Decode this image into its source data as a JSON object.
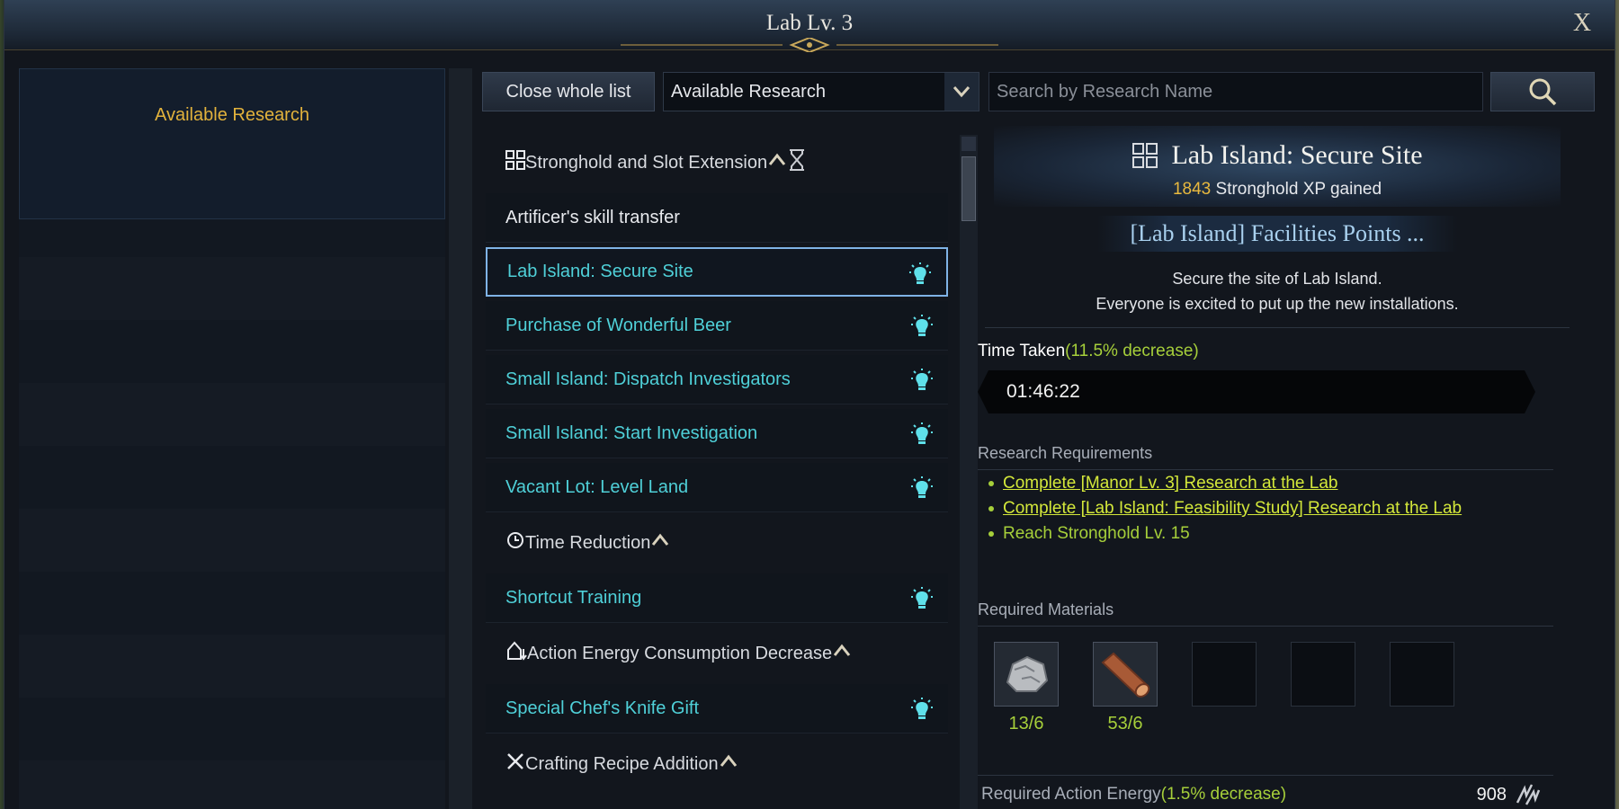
{
  "window": {
    "title": "Lab Lv. 3",
    "close_label": "X"
  },
  "left_panel": {
    "entry_label": "Available Research"
  },
  "toolbar": {
    "close_list_label": "Close whole list",
    "filter_selected": "Available Research",
    "search_placeholder": "Search by Research Name"
  },
  "research_list": [
    {
      "type": "category",
      "label": "Stronghold and Slot Extension",
      "icon": "grid-icon",
      "hourglass": true
    },
    {
      "type": "item",
      "label": "Artificer's skill transfer",
      "plain": true
    },
    {
      "type": "item",
      "label": "Lab Island: Secure Site",
      "selected": true,
      "bulb": true
    },
    {
      "type": "item",
      "label": "Purchase of Wonderful Beer",
      "bulb": true
    },
    {
      "type": "item",
      "label": "Small Island: Dispatch Investigators",
      "bulb": true
    },
    {
      "type": "item",
      "label": "Small Island: Start Investigation",
      "bulb": true
    },
    {
      "type": "item",
      "label": "Vacant Lot: Level Land",
      "bulb": true
    },
    {
      "type": "category",
      "label": "Time Reduction",
      "icon": "clock-icon"
    },
    {
      "type": "item",
      "label": "Shortcut Training",
      "bulb": true
    },
    {
      "type": "category",
      "label": "Action Energy Consumption Decrease",
      "icon": "house-arrow-icon"
    },
    {
      "type": "item",
      "label": "Special Chef's Knife Gift",
      "bulb": true
    },
    {
      "type": "category",
      "label": "Crafting Recipe Addition",
      "icon": "tools-icon"
    }
  ],
  "detail": {
    "title": "Lab Island: Secure Site",
    "xp_value": "1843",
    "xp_text": "Stronghold XP gained",
    "subtitle": "[Lab Island] Facilities Points ...",
    "desc_line1": "Secure the site of Lab Island.",
    "desc_line2": "Everyone is excited to put up the new installations.",
    "time_label": "Time Taken",
    "time_pct": "(11.5% decrease)",
    "time_value": "01:46:22",
    "requirements_label": "Research Requirements",
    "requirements": [
      {
        "text": "Complete [Manor Lv. 3] Research at the Lab",
        "link": true
      },
      {
        "text": "Complete [Lab Island: Feasibility Study] Research at the Lab",
        "link": true
      },
      {
        "text": "Reach Stronghold Lv. 15",
        "link": false
      }
    ],
    "materials_label": "Required Materials",
    "materials": [
      {
        "name": "ore-icon",
        "count": "13/6",
        "filled": true
      },
      {
        "name": "timber-icon",
        "count": "53/6",
        "filled": true
      },
      {
        "name": "empty-slot",
        "count": "",
        "filled": false
      },
      {
        "name": "empty-slot",
        "count": "",
        "filled": false
      },
      {
        "name": "empty-slot",
        "count": "",
        "filled": false
      }
    ],
    "energy_label": "Required Action Energy",
    "energy_pct": "(1.5% decrease)",
    "energy_value": "908"
  },
  "colors": {
    "accent_gold": "#e9b93e",
    "item_cyan": "#4fd0d8",
    "positive_green": "#a6cf3a",
    "link_yellow": "#d4e83a"
  }
}
